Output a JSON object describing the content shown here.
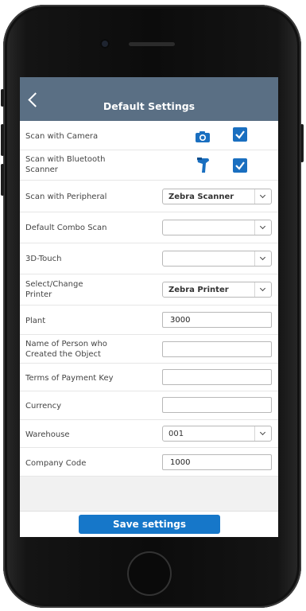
{
  "header": {
    "title": "Default Settings"
  },
  "rows": {
    "scan_camera": {
      "label": "Scan with Camera",
      "checked": true
    },
    "scan_bluetooth": {
      "label_line1": "Scan with Bluetooth",
      "label_line2": "Scanner",
      "checked": true
    },
    "scan_peripheral": {
      "label": "Scan with Peripheral",
      "value": "Zebra Scanner"
    },
    "combo_scan": {
      "label": "Default Combo Scan",
      "value": ""
    },
    "touch3d": {
      "label": "3D-Touch",
      "value": ""
    },
    "printer": {
      "label_line1": "Select/Change",
      "label_line2": "Printer",
      "value": "Zebra Printer"
    },
    "plant": {
      "label": "Plant",
      "value": "3000"
    },
    "creator": {
      "label_line1": "Name of Person who",
      "label_line2": "Created the Object",
      "value": ""
    },
    "payment_terms": {
      "label": "Terms of Payment Key",
      "value": ""
    },
    "currency": {
      "label": "Currency",
      "value": ""
    },
    "warehouse": {
      "label": "Warehouse",
      "value": "001"
    },
    "company_code": {
      "label": "Company Code",
      "value": "1000"
    }
  },
  "footer": {
    "save_label": "Save settings"
  },
  "colors": {
    "header_bg": "#5a6f84",
    "accent": "#1677c9",
    "checkbox": "#1a6fc0"
  },
  "icons": {
    "camera": "camera-icon",
    "bluetooth_scanner": "barcode-scanner-icon",
    "back": "chevron-left-icon"
  }
}
